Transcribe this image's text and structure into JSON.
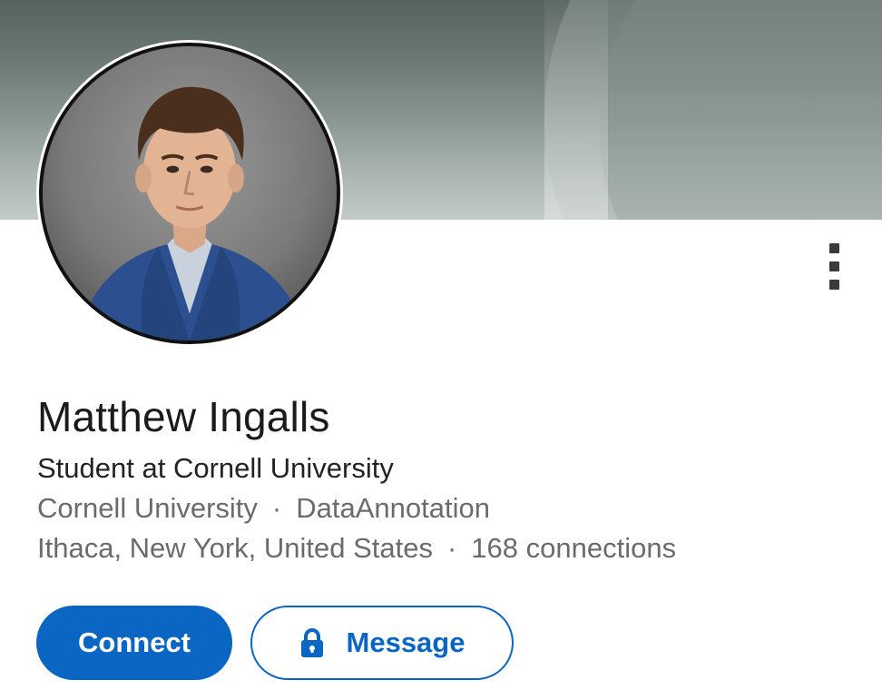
{
  "profile": {
    "name": "Matthew Ingalls",
    "headline": "Student at Cornell University",
    "education": "Cornell University",
    "current_company": "DataAnnotation",
    "location": "Ithaca, New York, United States",
    "connections": "168 connections",
    "separator": "·"
  },
  "actions": {
    "connect_label": "Connect",
    "message_label": "Message"
  },
  "icons": {
    "more": "more-vertical-icon",
    "message": "lock-icon"
  },
  "colors": {
    "primary": "#0a66c2",
    "cover_top": "#56625f",
    "cover_bottom": "#c2cac8",
    "text_primary": "#1b1b1b",
    "text_secondary": "#6b6b6b"
  }
}
